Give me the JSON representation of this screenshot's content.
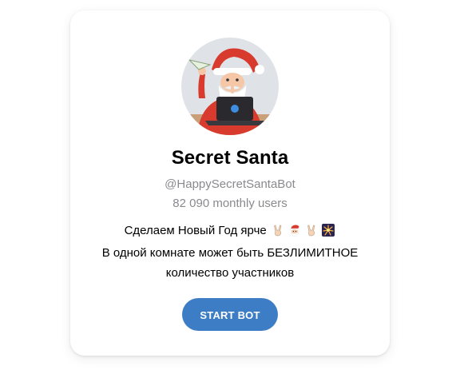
{
  "bot": {
    "title": "Secret Santa",
    "username": "@HappySecretSantaBot",
    "monthly_users": "82 090 monthly users",
    "description_line1": "Сделаем Новый Год ярче",
    "description_line1_emojis": [
      "victory-hand-emoji",
      "santa-emoji",
      "victory-hand-emoji",
      "fireworks-emoji"
    ],
    "description_line2": "В одной комнате может быть БЕЗЛИМИТНОЕ",
    "description_line3": "количество участников",
    "start_label": "START BOT"
  },
  "colors": {
    "button": "#3d7dc5",
    "secondary_text": "#8a8a8e",
    "avatar_bg": "#dfe3e8"
  }
}
